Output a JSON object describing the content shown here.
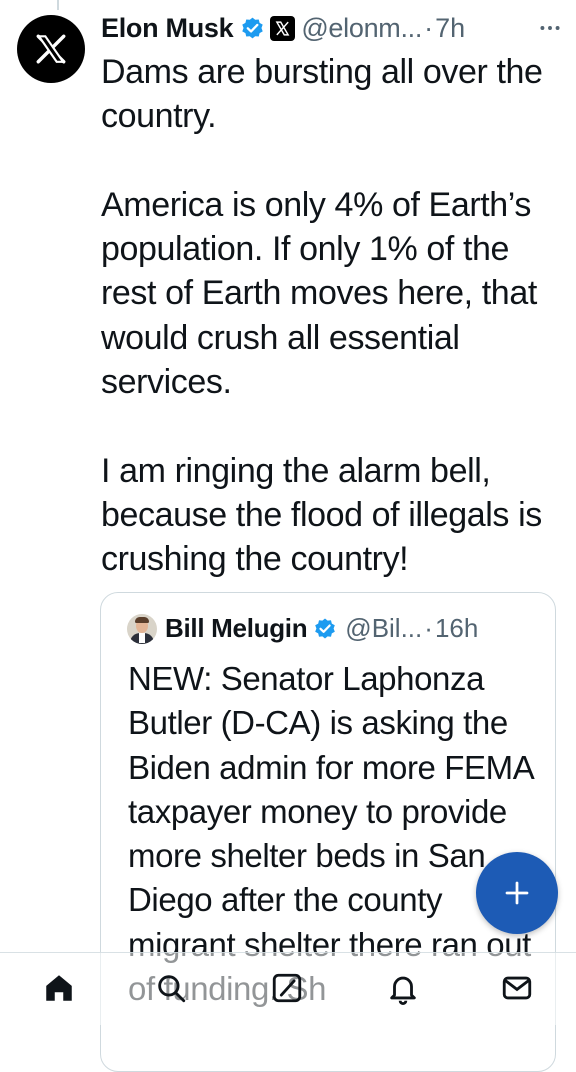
{
  "tweet": {
    "author_name": "Elon Musk",
    "handle": "@elonm...",
    "separator": "·",
    "time": "7h",
    "more_label": "More",
    "avatar_icon": "x-logo-icon",
    "verified_icon": "verified-badge-icon",
    "affiliation_icon": "x-affiliation-badge-icon",
    "paragraphs": [
      "Dams are bursting all over the country.",
      "America is only 4% of Earth’s population. If only 1% of the rest of Earth moves here, that would crush all essential services.",
      "I am ringing the alarm bell, because the flood of illegals is crushing the country!"
    ]
  },
  "quote": {
    "author_name": "Bill Melugin",
    "handle": "@Bil...",
    "separator": "·",
    "time": "16h",
    "text": "NEW: Senator Laphonza Butler (D-CA) is asking the Biden admin for more FEMA taxpayer money to provide more shelter beds in San Diego after the county migrant shelter there ran out of funding. Sh"
  },
  "compose_button": {
    "icon": "plus-icon",
    "label": "+"
  },
  "bottom_nav": {
    "items": [
      {
        "name": "home",
        "icon": "home-icon"
      },
      {
        "name": "search",
        "icon": "search-icon"
      },
      {
        "name": "grok",
        "icon": "grok-icon"
      },
      {
        "name": "notifications",
        "icon": "bell-icon"
      },
      {
        "name": "messages",
        "icon": "envelope-icon"
      }
    ]
  },
  "colors": {
    "text_primary": "#0f1419",
    "text_secondary": "#536471",
    "verified_blue": "#1d9bf0",
    "fab_blue": "#1d5bb5",
    "border": "#cfd9de"
  }
}
